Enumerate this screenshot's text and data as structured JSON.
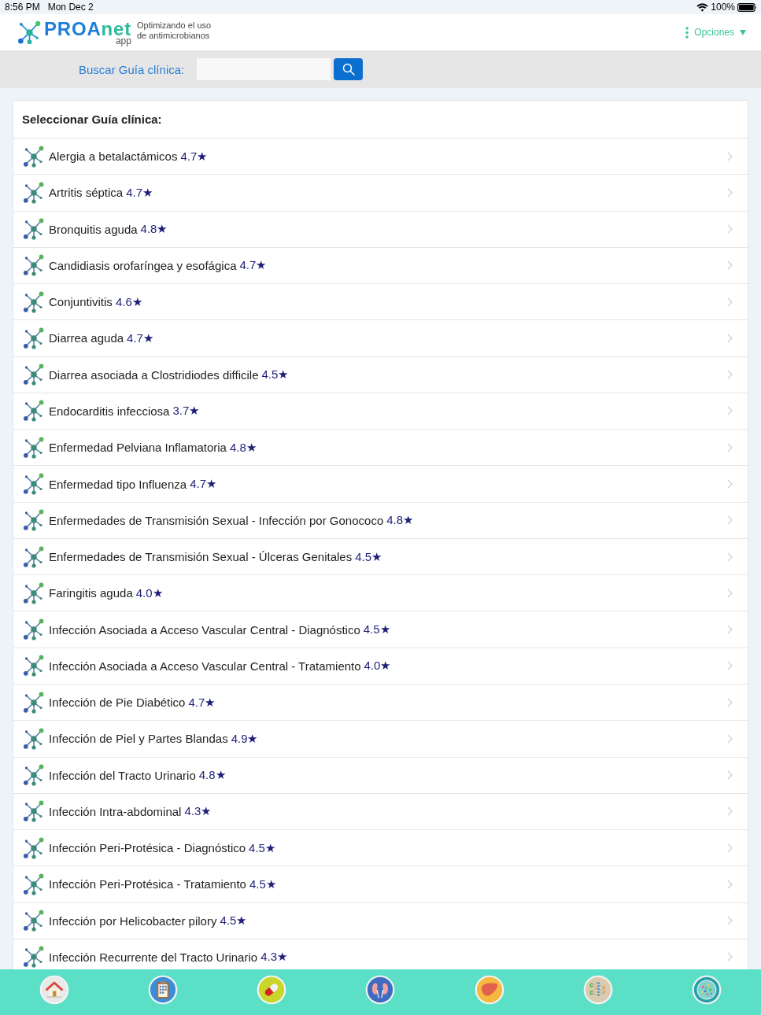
{
  "status_bar": {
    "time": "8:56 PM",
    "date": "Mon Dec 2",
    "battery": "100%"
  },
  "header": {
    "logo": {
      "wordmark": [
        "PROA",
        "net"
      ],
      "suffix": "app"
    },
    "tagline": [
      "Optimizando el uso",
      "de antimicrobianos"
    ],
    "options_menu": {
      "label": "Opciones"
    }
  },
  "search": {
    "label": "Buscar Guía clínica:"
  },
  "guide_list": {
    "title": "Seleccionar Guía clínica:",
    "items": [
      {
        "name": "Alergia a betalactámicos",
        "rating": "4.7★"
      },
      {
        "name": "Artritis séptica",
        "rating": "4.7★"
      },
      {
        "name": "Bronquitis aguda",
        "rating": "4.8★"
      },
      {
        "name": "Candidiasis orofaríngea y esofágica",
        "rating": "4.7★"
      },
      {
        "name": "Conjuntivitis",
        "rating": "4.6★"
      },
      {
        "name": "Diarrea aguda",
        "rating": "4.7★"
      },
      {
        "name": "Diarrea asociada a Clostridiodes difficile",
        "rating": "4.5★"
      },
      {
        "name": "Endocarditis infecciosa",
        "rating": "3.7★"
      },
      {
        "name": "Enfermedad Pelviana Inflamatoria",
        "rating": "4.8★"
      },
      {
        "name": "Enfermedad tipo Influenza",
        "rating": "4.7★"
      },
      {
        "name": "Enfermedades de Transmisión Sexual - Infección por Gonococo",
        "rating": "4.8★"
      },
      {
        "name": "Enfermedades de Transmisión Sexual - Úlceras Genitales",
        "rating": "4.5★"
      },
      {
        "name": "Faringitis aguda",
        "rating": "4.0★"
      },
      {
        "name": "Infección Asociada a Acceso Vascular Central - Diagnóstico",
        "rating": "4.5★"
      },
      {
        "name": "Infección Asociada a Acceso Vascular Central - Tratamiento",
        "rating": "4.0★"
      },
      {
        "name": "Infección de Pie Diabético",
        "rating": "4.7★"
      },
      {
        "name": "Infección de Piel y Partes Blandas",
        "rating": "4.9★"
      },
      {
        "name": "Infección del Tracto Urinario",
        "rating": "4.8★"
      },
      {
        "name": "Infección Intra-abdominal",
        "rating": "4.3★"
      },
      {
        "name": "Infección Peri-Protésica - Diagnóstico",
        "rating": "4.5★"
      },
      {
        "name": "Infección Peri-Protésica - Tratamiento",
        "rating": "4.5★"
      },
      {
        "name": "Infección por Helicobacter pilory",
        "rating": "4.5★"
      },
      {
        "name": "Infección Recurrente del Tracto Urinario",
        "rating": "4.3★"
      }
    ]
  },
  "tab_bar": [
    {
      "kind": "home"
    },
    {
      "kind": "clipboard"
    },
    {
      "kind": "capsule"
    },
    {
      "kind": "kidneys"
    },
    {
      "kind": "liver"
    },
    {
      "kind": "network"
    },
    {
      "kind": "petri_dish"
    }
  ]
}
